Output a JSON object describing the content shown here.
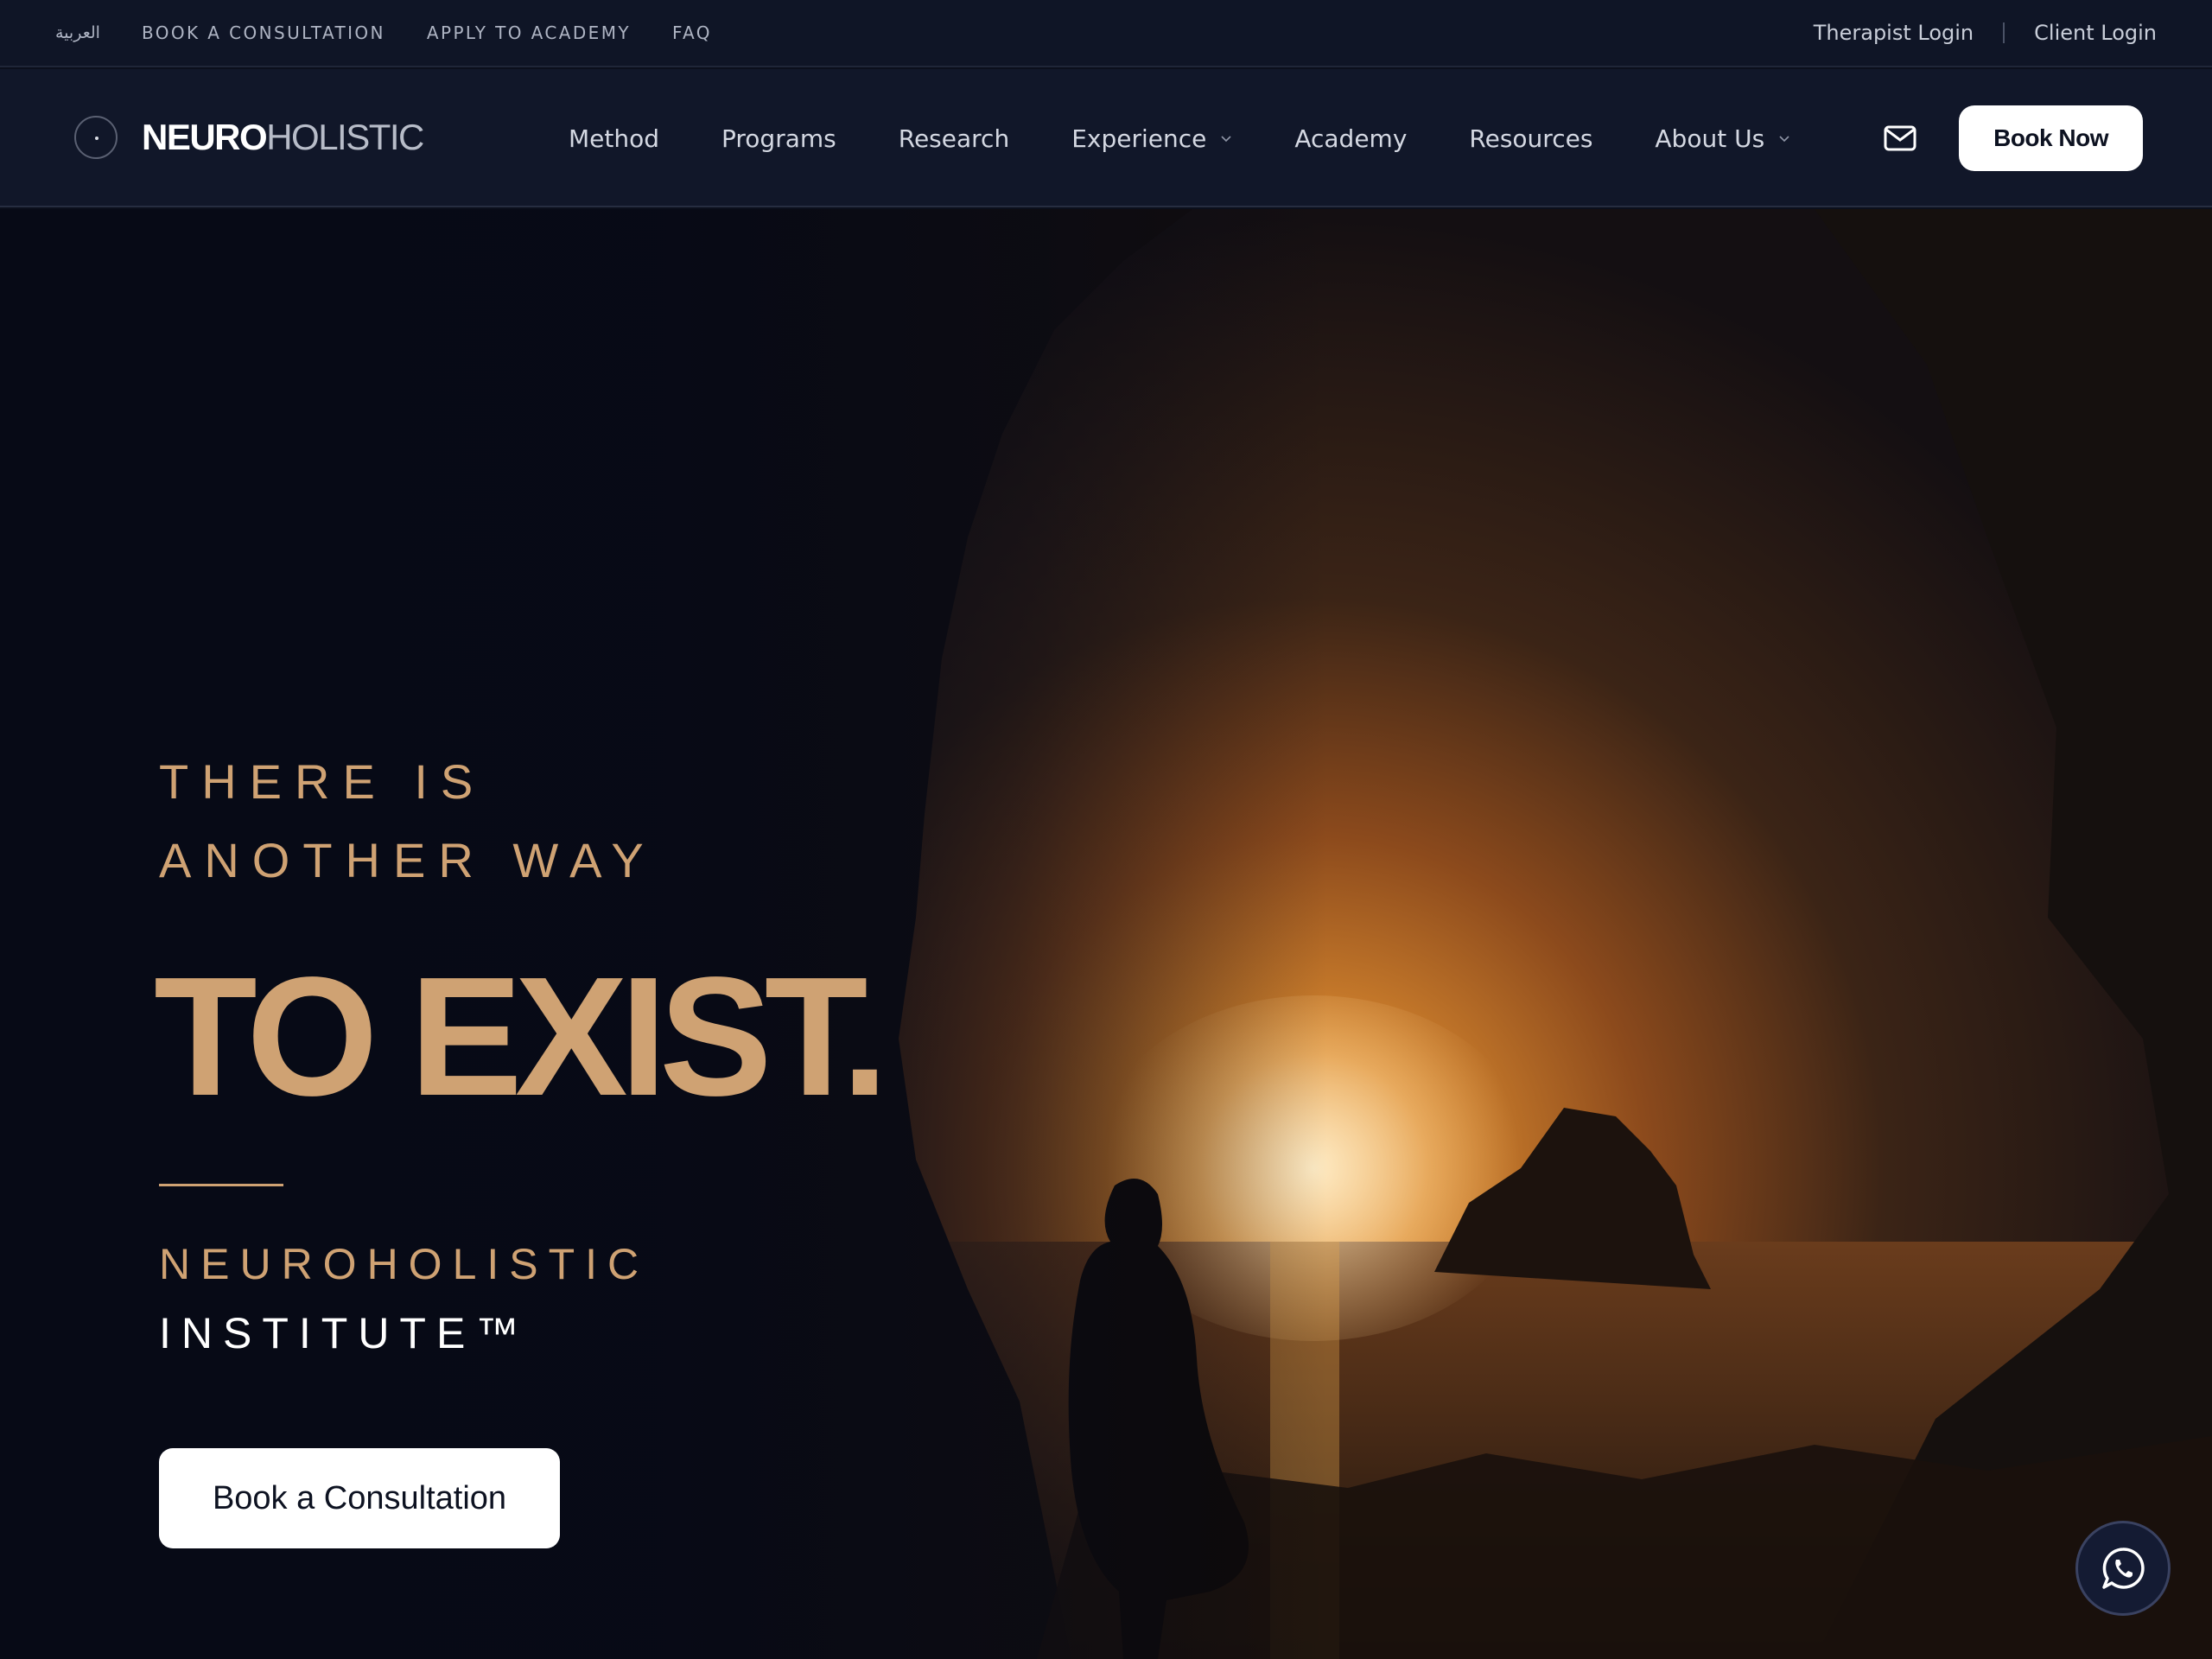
{
  "utility_bar": {
    "links": [
      {
        "label": "العربية"
      },
      {
        "label": "BOOK A CONSULTATION"
      },
      {
        "label": "APPLY TO ACADEMY"
      },
      {
        "label": "FAQ"
      }
    ],
    "therapist_login": "Therapist Login",
    "separator": "|",
    "client_login": "Client Login"
  },
  "nav": {
    "logo_bold": "NEURO",
    "logo_light": "HOLISTIC",
    "items": [
      {
        "label": "Method",
        "has_dropdown": false
      },
      {
        "label": "Programs",
        "has_dropdown": false
      },
      {
        "label": "Research",
        "has_dropdown": false
      },
      {
        "label": "Experience",
        "has_dropdown": true
      },
      {
        "label": "Academy",
        "has_dropdown": false
      },
      {
        "label": "Resources",
        "has_dropdown": false
      },
      {
        "label": "About Us",
        "has_dropdown": true
      }
    ],
    "mail_icon": "mail-icon",
    "book_now": "Book Now"
  },
  "hero": {
    "kicker_line1": "THERE IS",
    "kicker_line2": "ANOTHER WAY",
    "headline": "TO EXIST.",
    "institute_line1": "NEUROHOLISTIC",
    "institute_line2": "INSTITUTE™",
    "cta_label": "Book a Consultation",
    "chat_icon": "whatsapp-icon"
  },
  "colors": {
    "accent_gold": "#cfa273",
    "nav_bg": "#111729",
    "util_bg": "#0f1526",
    "button_bg": "#ffffff"
  }
}
